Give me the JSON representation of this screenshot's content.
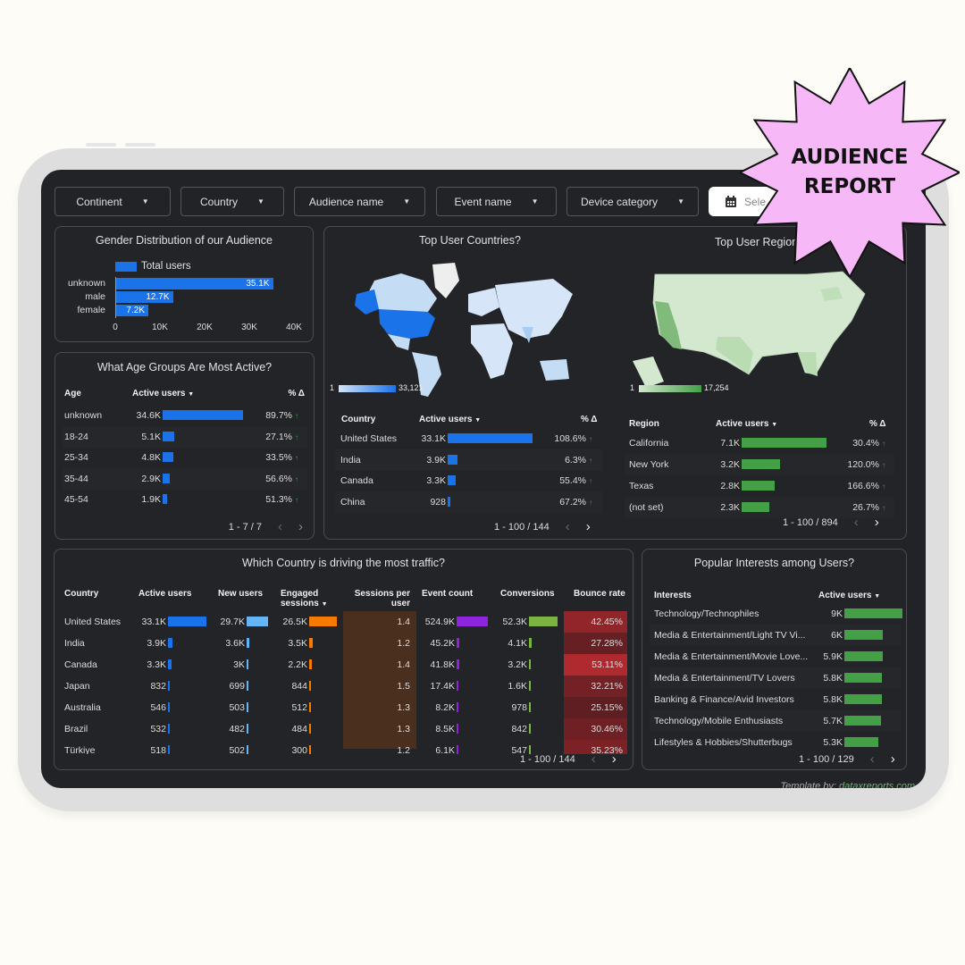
{
  "filters": [
    {
      "label": "Continent"
    },
    {
      "label": "Country"
    },
    {
      "label": "Audience name"
    },
    {
      "label": "Event name"
    },
    {
      "label": "Device category"
    }
  ],
  "date_picker": {
    "label": "Sele",
    "icon": "calendar-icon"
  },
  "badge": {
    "line1": "AUDIENCE",
    "line2": "REPORT",
    "color": "#f6b8f7"
  },
  "gender": {
    "title": "Gender Distribution of our Audience",
    "legend": "Total users",
    "bar_color": "#1a73e8",
    "chart_data": {
      "type": "bar",
      "orientation": "horizontal",
      "categories": [
        "unknown",
        "male",
        "female"
      ],
      "values": [
        35100,
        12700,
        7200
      ],
      "labels": [
        "35.1K",
        "12.7K",
        "7.2K"
      ],
      "xlim": [
        0,
        40000
      ],
      "ticks": [
        "0",
        "10K",
        "20K",
        "30K",
        "40K"
      ]
    }
  },
  "age": {
    "title": "What Age Groups Are Most Active?",
    "headers": {
      "age": "Age",
      "users": "Active users",
      "delta": "% Δ"
    },
    "rows": [
      {
        "age": "unknown",
        "users": "34.6K",
        "value": 34600,
        "delta": "89.7%"
      },
      {
        "age": "18-24",
        "users": "5.1K",
        "value": 5100,
        "delta": "27.1%"
      },
      {
        "age": "25-34",
        "users": "4.8K",
        "value": 4800,
        "delta": "33.5%"
      },
      {
        "age": "35-44",
        "users": "2.9K",
        "value": 2900,
        "delta": "56.6%"
      },
      {
        "age": "45-54",
        "users": "1.9K",
        "value": 1900,
        "delta": "51.3%"
      }
    ],
    "pager": "1 - 7 / 7"
  },
  "countries": {
    "title": "Top User Countries?",
    "legend_min": "1",
    "legend_max": "33,121",
    "headers": {
      "country": "Country",
      "users": "Active users",
      "delta": "% Δ"
    },
    "rows": [
      {
        "country": "United States",
        "users": "33.1K",
        "value": 33100,
        "delta": "108.6%"
      },
      {
        "country": "India",
        "users": "3.9K",
        "value": 3900,
        "delta": "6.3%"
      },
      {
        "country": "Canada",
        "users": "3.3K",
        "value": 3300,
        "delta": "55.4%"
      },
      {
        "country": "China",
        "users": "928",
        "value": 928,
        "delta": "67.2%"
      }
    ],
    "pager": "1 - 100 / 144"
  },
  "regions": {
    "title": "Top User Region",
    "legend_min": "1",
    "legend_max": "17,254",
    "headers": {
      "region": "Region",
      "users": "Active users",
      "delta": "% Δ"
    },
    "rows": [
      {
        "region": "California",
        "users": "7.1K",
        "value": 7100,
        "delta": "30.4%"
      },
      {
        "region": "New York",
        "users": "3.2K",
        "value": 3200,
        "delta": "120.0%"
      },
      {
        "region": "Texas",
        "users": "2.8K",
        "value": 2800,
        "delta": "166.6%"
      },
      {
        "region": "(not set)",
        "users": "2.3K",
        "value": 2300,
        "delta": "26.7%"
      }
    ],
    "pager": "1 - 100 / 894"
  },
  "traffic": {
    "title": "Which Country is driving the most traffic?",
    "headers": {
      "country": "Country",
      "active": "Active users",
      "new": "New users",
      "engaged1": "Engaged",
      "engaged2": "sessions",
      "spu1": "Sessions per",
      "spu2": "user",
      "events": "Event count",
      "conv": "Conversions",
      "bounce": "Bounce rate"
    },
    "rows": [
      {
        "country": "United States",
        "active": "33.1K",
        "active_v": 33100,
        "new": "29.7K",
        "new_v": 29700,
        "engaged": "26.5K",
        "engaged_v": 26500,
        "spu": "1.4",
        "events": "524.9K",
        "events_v": 524900,
        "conv": "52.3K",
        "conv_v": 52300,
        "bounce": "42.45%",
        "bounce_v": 42.45
      },
      {
        "country": "India",
        "active": "3.9K",
        "active_v": 3900,
        "new": "3.6K",
        "new_v": 3600,
        "engaged": "3.5K",
        "engaged_v": 3500,
        "spu": "1.2",
        "events": "45.2K",
        "events_v": 45200,
        "conv": "4.1K",
        "conv_v": 4100,
        "bounce": "27.28%",
        "bounce_v": 27.28
      },
      {
        "country": "Canada",
        "active": "3.3K",
        "active_v": 3300,
        "new": "3K",
        "new_v": 3000,
        "engaged": "2.2K",
        "engaged_v": 2200,
        "spu": "1.4",
        "events": "41.8K",
        "events_v": 41800,
        "conv": "3.2K",
        "conv_v": 3200,
        "bounce": "53.11%",
        "bounce_v": 53.11
      },
      {
        "country": "Japan",
        "active": "832",
        "active_v": 832,
        "new": "699",
        "new_v": 699,
        "engaged": "844",
        "engaged_v": 844,
        "spu": "1.5",
        "events": "17.4K",
        "events_v": 17400,
        "conv": "1.6K",
        "conv_v": 1600,
        "bounce": "32.21%",
        "bounce_v": 32.21
      },
      {
        "country": "Australia",
        "active": "546",
        "active_v": 546,
        "new": "503",
        "new_v": 503,
        "engaged": "512",
        "engaged_v": 512,
        "spu": "1.3",
        "events": "8.2K",
        "events_v": 8200,
        "conv": "978",
        "conv_v": 978,
        "bounce": "25.15%",
        "bounce_v": 25.15
      },
      {
        "country": "Brazil",
        "active": "532",
        "active_v": 532,
        "new": "482",
        "new_v": 482,
        "engaged": "484",
        "engaged_v": 484,
        "spu": "1.3",
        "events": "8.5K",
        "events_v": 8500,
        "conv": "842",
        "conv_v": 842,
        "bounce": "30.46%",
        "bounce_v": 30.46
      },
      {
        "country": "Türkiye",
        "active": "518",
        "active_v": 518,
        "new": "502",
        "new_v": 502,
        "engaged": "300",
        "engaged_v": 300,
        "spu": "1.2",
        "events": "6.1K",
        "events_v": 6100,
        "conv": "547",
        "conv_v": 547,
        "bounce": "35.23%",
        "bounce_v": 35.23
      }
    ],
    "colors": {
      "active": "#1a73e8",
      "new": "#64b5f6",
      "engaged": "#f57c00",
      "events": "#8e24dc",
      "conv": "#7cb342"
    },
    "pager": "1 - 100 / 144"
  },
  "interests": {
    "title": "Popular Interests among Users?",
    "headers": {
      "interest": "Interests",
      "users": "Active users"
    },
    "rows": [
      {
        "interest": "Technology/Technophiles",
        "users": "9K",
        "value": 9000
      },
      {
        "interest": "Media & Entertainment/Light TV Vi...",
        "users": "6K",
        "value": 6000
      },
      {
        "interest": "Media & Entertainment/Movie Love...",
        "users": "5.9K",
        "value": 5900
      },
      {
        "interest": "Media & Entertainment/TV Lovers",
        "users": "5.8K",
        "value": 5800
      },
      {
        "interest": "Banking & Finance/Avid Investors",
        "users": "5.8K",
        "value": 5800
      },
      {
        "interest": "Technology/Mobile Enthusiasts",
        "users": "5.7K",
        "value": 5700
      },
      {
        "interest": "Lifestyles & Hobbies/Shutterbugs",
        "users": "5.3K",
        "value": 5300
      }
    ],
    "pager": "1 - 100 / 129"
  },
  "footer": {
    "prefix": "Template by: ",
    "link": "dataxreports.com"
  }
}
